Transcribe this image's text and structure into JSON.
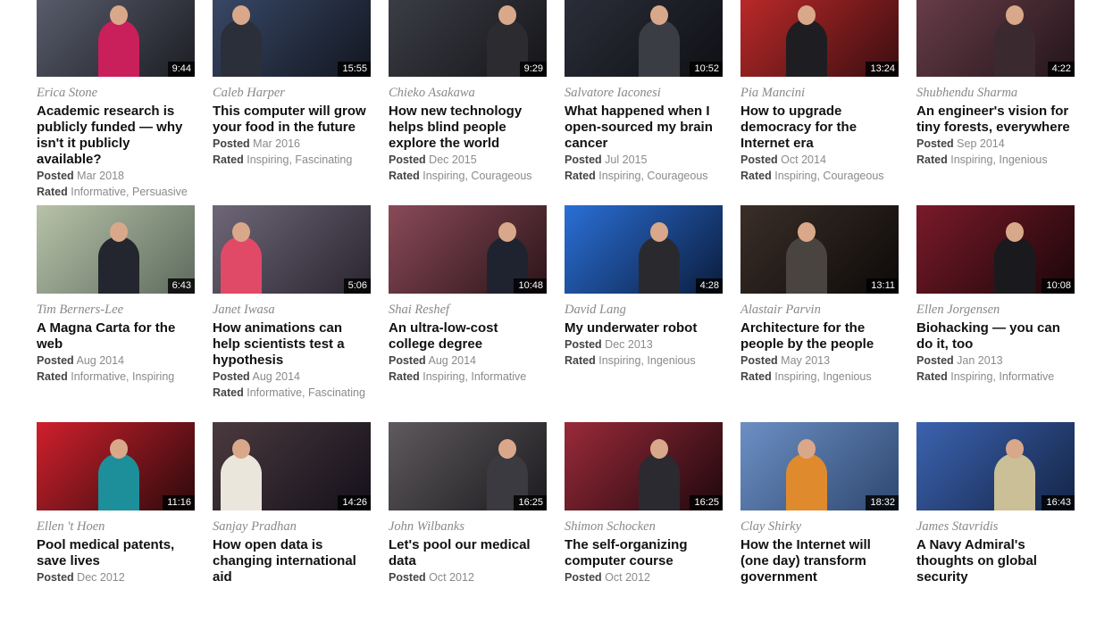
{
  "labels": {
    "posted": "Posted",
    "rated": "Rated"
  },
  "talks": [
    {
      "speaker": "Erica Stone",
      "title": "Academic research is publicly funded — why isn't it publicly available?",
      "duration": "9:44",
      "posted": "Mar 2018",
      "rated": "Informative, Persuasive",
      "colors": [
        "#5b5f6e",
        "#1c1d24"
      ],
      "figure": "#c91f5a"
    },
    {
      "speaker": "Caleb Harper",
      "title": "This computer will grow your food in the future",
      "duration": "15:55",
      "posted": "Mar 2016",
      "rated": "Inspiring, Fascinating",
      "colors": [
        "#3a4a6a",
        "#12161f"
      ],
      "figure": "#2a2f3a"
    },
    {
      "speaker": "Chieko Asakawa",
      "title": "How new technology helps blind people explore the world",
      "duration": "9:29",
      "posted": "Dec 2015",
      "rated": "Inspiring, Courageous",
      "colors": [
        "#3d3f48",
        "#151518"
      ],
      "figure": "#2b2b30"
    },
    {
      "speaker": "Salvatore Iaconesi",
      "title": "What happened when I open-sourced my brain cancer",
      "duration": "10:52",
      "posted": "Jul 2015",
      "rated": "Inspiring, Courageous",
      "colors": [
        "#2c2f3a",
        "#0f1015"
      ],
      "figure": "#3a3d44"
    },
    {
      "speaker": "Pia Mancini",
      "title": "How to upgrade democracy for the Internet era",
      "duration": "13:24",
      "posted": "Oct 2014",
      "rated": "Inspiring, Courageous",
      "colors": [
        "#c02a2a",
        "#3a0e10"
      ],
      "figure": "#1e1e22"
    },
    {
      "speaker": "Shubhendu Sharma",
      "title": "An engineer's vision for tiny forests, everywhere",
      "duration": "4:22",
      "posted": "Sep 2014",
      "rated": "Inspiring, Ingenious",
      "colors": [
        "#6a3e4a",
        "#23151a"
      ],
      "figure": "#3a2a30"
    },
    {
      "speaker": "Tim Berners-Lee",
      "title": "A Magna Carta for the web",
      "duration": "6:43",
      "posted": "Aug 2014",
      "rated": "Informative, Inspiring",
      "colors": [
        "#b7c2a8",
        "#5d6b5e"
      ],
      "figure": "#23262e"
    },
    {
      "speaker": "Janet Iwasa",
      "title": "How animations can help scientists test a hypothesis",
      "duration": "5:06",
      "posted": "Aug 2014",
      "rated": "Informative, Fascinating",
      "colors": [
        "#6e6778",
        "#2a2530"
      ],
      "figure": "#e04a66"
    },
    {
      "speaker": "Shai Reshef",
      "title": "An ultra-low-cost college degree",
      "duration": "10:48",
      "posted": "Aug 2014",
      "rated": "Inspiring, Informative",
      "colors": [
        "#8a4a58",
        "#2a1418"
      ],
      "figure": "#1f2330"
    },
    {
      "speaker": "David Lang",
      "title": "My underwater robot",
      "duration": "4:28",
      "posted": "Dec 2013",
      "rated": "Inspiring, Ingenious",
      "colors": [
        "#2a6fd6",
        "#0b1c3c"
      ],
      "figure": "#2a2a2e"
    },
    {
      "speaker": "Alastair Parvin",
      "title": "Architecture for the people by the people",
      "duration": "13:11",
      "posted": "May 2013",
      "rated": "Inspiring, Ingenious",
      "colors": [
        "#3a2e28",
        "#0d0a09"
      ],
      "figure": "#4a4440"
    },
    {
      "speaker": "Ellen Jorgensen",
      "title": "Biohacking — you can do it, too",
      "duration": "10:08",
      "posted": "Jan 2013",
      "rated": "Inspiring, Informative",
      "colors": [
        "#7a1a2a",
        "#1a0608"
      ],
      "figure": "#1a1a1e"
    },
    {
      "speaker": "Ellen 't Hoen",
      "title": "Pool medical patents, save lives",
      "duration": "11:16",
      "posted": "Dec 2012",
      "rated": "",
      "colors": [
        "#d0202c",
        "#2a0a0c"
      ],
      "figure": "#1d8f9a"
    },
    {
      "speaker": "Sanjay Pradhan",
      "title": "How open data is changing international aid",
      "duration": "14:26",
      "posted": "",
      "rated": "",
      "colors": [
        "#4a3a3e",
        "#14101a"
      ],
      "figure": "#eae6dc"
    },
    {
      "speaker": "John Wilbanks",
      "title": "Let's pool our medical data",
      "duration": "16:25",
      "posted": "Oct 2012",
      "rated": "",
      "colors": [
        "#5e5a5e",
        "#1c1a1e"
      ],
      "figure": "#3a3a40"
    },
    {
      "speaker": "Shimon Schocken",
      "title": "The self-organizing computer course",
      "duration": "16:25",
      "posted": "Oct 2012",
      "rated": "",
      "colors": [
        "#9a2a3a",
        "#1e080c"
      ],
      "figure": "#2a2a30"
    },
    {
      "speaker": "Clay Shirky",
      "title": "How the Internet will (one day) transform government",
      "duration": "18:32",
      "posted": "",
      "rated": "",
      "colors": [
        "#6c8fc4",
        "#2e4870"
      ],
      "figure": "#e08a2e"
    },
    {
      "speaker": "James Stavridis",
      "title": "A Navy Admiral's thoughts on global security",
      "duration": "16:43",
      "posted": "",
      "rated": "",
      "colors": [
        "#3c63b0",
        "#142446"
      ],
      "figure": "#cbbf98"
    }
  ]
}
